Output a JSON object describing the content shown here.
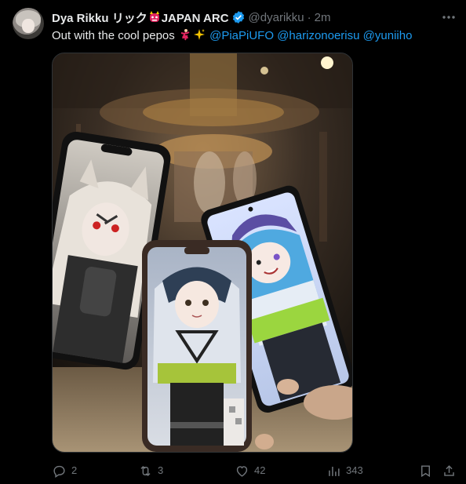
{
  "author": {
    "name_part1": "Dya Rikku リック",
    "name_part2": "JAPAN ARC",
    "handle": "@dyarikku",
    "separator": "·",
    "time": "2m"
  },
  "post": {
    "text": "Out with the cool pepos",
    "mentions": [
      "@PiaPiUFO",
      "@harizonoerisu",
      "@yuniiho"
    ]
  },
  "actions": {
    "replies": "2",
    "reposts": "3",
    "likes": "42",
    "views": "343"
  },
  "icons": [
    "more-icon",
    "verified-icon",
    "reply-icon",
    "repost-icon",
    "like-icon",
    "views-icon",
    "bookmark-icon",
    "share-icon"
  ],
  "colors": {
    "accent": "#1d9bf0",
    "muted": "#71767b",
    "text": "#e7e9ea",
    "background": "#000000"
  }
}
